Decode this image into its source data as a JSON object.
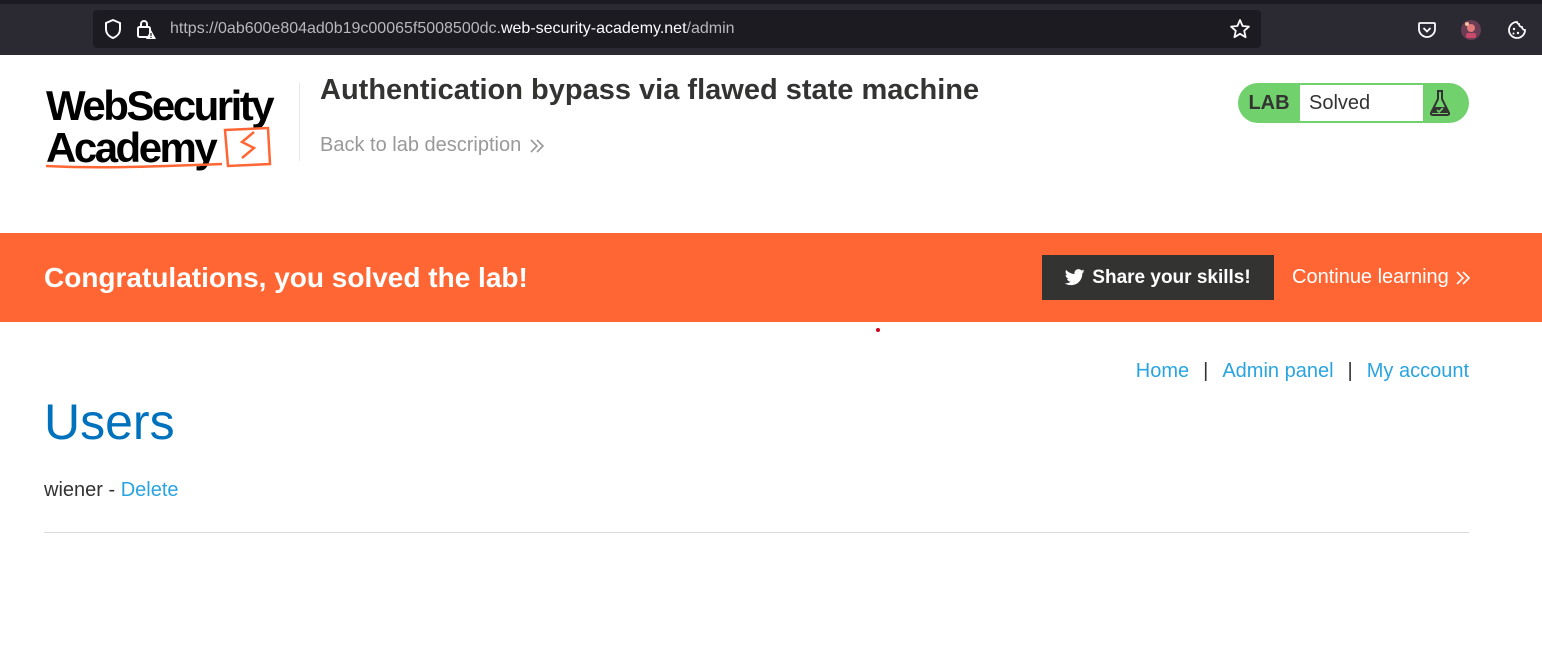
{
  "browser": {
    "url_prefix": "https://0ab600e804ad0b19c00065f5008500dc.",
    "url_host": "web-security-academy.net",
    "url_path": "/admin",
    "icons": [
      "shield-icon",
      "lock-warning-icon",
      "bookmark-star-icon",
      "pocket-icon",
      "profile-avatar-icon",
      "cookie-icon"
    ]
  },
  "header": {
    "logo_line1": "WebSecurity",
    "logo_line2": "Academy",
    "lab_title": "Authentication bypass via flawed state machine",
    "back_link": "Back to lab description",
    "lab_tag": "LAB",
    "lab_state": "Solved",
    "lab_state_color": "#70d16d"
  },
  "banner": {
    "message": "Congratulations, you solved the lab!",
    "share_label": "Share your skills!",
    "continue_label": "Continue learning",
    "color": "#ff6633"
  },
  "nav": {
    "home": "Home",
    "admin_panel": "Admin panel",
    "my_account": "My account",
    "separator": "|"
  },
  "main": {
    "heading": "Users",
    "users": [
      {
        "name": "wiener",
        "separator": "-",
        "action": "Delete"
      }
    ]
  },
  "colors": {
    "link": "#29a4e0",
    "heading": "#0071bc",
    "accent": "#ff6633"
  }
}
